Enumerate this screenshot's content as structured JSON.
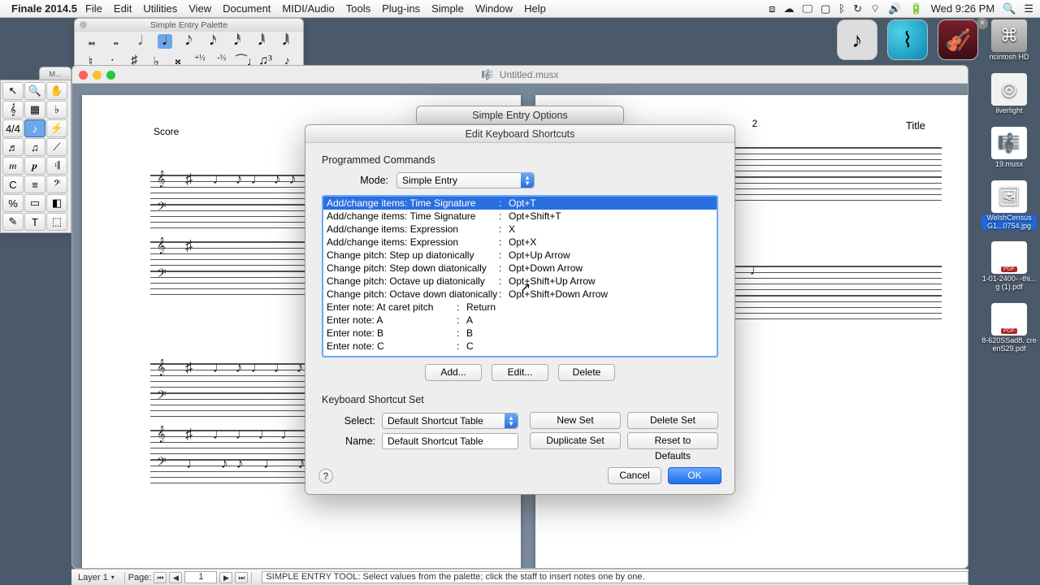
{
  "menubar": {
    "app": "Finale 2014.5",
    "items": [
      "File",
      "Edit",
      "Utilities",
      "View",
      "Document",
      "MIDI/Audio",
      "Tools",
      "Plug-ins",
      "Simple",
      "Window",
      "Help"
    ],
    "clock": "Wed 9:26 PM"
  },
  "simple_entry_palette": {
    "title": "Simple Entry Palette"
  },
  "tool_palette": {
    "title": "M..."
  },
  "document": {
    "filename": "Untitled.musx",
    "left_page": {
      "score": "Score"
    },
    "right_page": {
      "page_number": "2",
      "title": "Title"
    }
  },
  "simple_options_dialog": {
    "title": "Simple Entry Options"
  },
  "shortcuts_dialog": {
    "title": "Edit Keyboard Shortcuts",
    "programmed_label": "Programmed Commands",
    "mode_label": "Mode:",
    "mode_value": "Simple Entry",
    "commands": [
      {
        "name": "Add/change items: Time Signature",
        "key": "Opt+T",
        "sel": true
      },
      {
        "name": "Add/change items: Time Signature",
        "key": "Opt+Shift+T"
      },
      {
        "name": "Add/change items: Expression",
        "key": "X"
      },
      {
        "name": "Add/change items: Expression",
        "key": "Opt+X"
      },
      {
        "name": "Change pitch: Step up diatonically",
        "key": "Opt+Up Arrow"
      },
      {
        "name": "Change pitch: Step down diatonically",
        "key": "Opt+Down Arrow"
      },
      {
        "name": "Change pitch: Octave up diatonically",
        "key": "Opt+Shift+Up Arrow"
      },
      {
        "name": "Change pitch: Octave down diatonically",
        "key": "Opt+Shift+Down Arrow"
      },
      {
        "name": "Enter note: At caret pitch",
        "key": "Return"
      },
      {
        "name": "Enter note: A",
        "key": "A"
      },
      {
        "name": "Enter note: B",
        "key": "B"
      },
      {
        "name": "Enter note: C",
        "key": "C"
      }
    ],
    "add_btn": "Add...",
    "edit_btn": "Edit...",
    "delete_btn": "Delete",
    "set_label": "Keyboard Shortcut Set",
    "select_label": "Select:",
    "select_value": "Default Shortcut Table",
    "name_label": "Name:",
    "name_value": "Default Shortcut Table",
    "newset_btn": "New Set",
    "deleteset_btn": "Delete Set",
    "dupset_btn": "Duplicate Set",
    "reset_btn": "Reset to Defaults",
    "cancel_btn": "Cancel",
    "ok_btn": "OK"
  },
  "statusbar": {
    "layer": "Layer 1",
    "page_label": "Page:",
    "page_value": "1",
    "hint": "SIMPLE ENTRY TOOL: Select values from the palette; click the staff to insert notes one by one."
  },
  "desktop": {
    "hd": "ncintosh HD",
    "sl": "ilverlight",
    "doc1": "19.musx",
    "census": "WelshCensus G1...0754.jpg",
    "pdf1": "1-01-2400-   -thi...g (1).pdf",
    "pdf2": "8-620SSad8. creenS29.pdf"
  }
}
